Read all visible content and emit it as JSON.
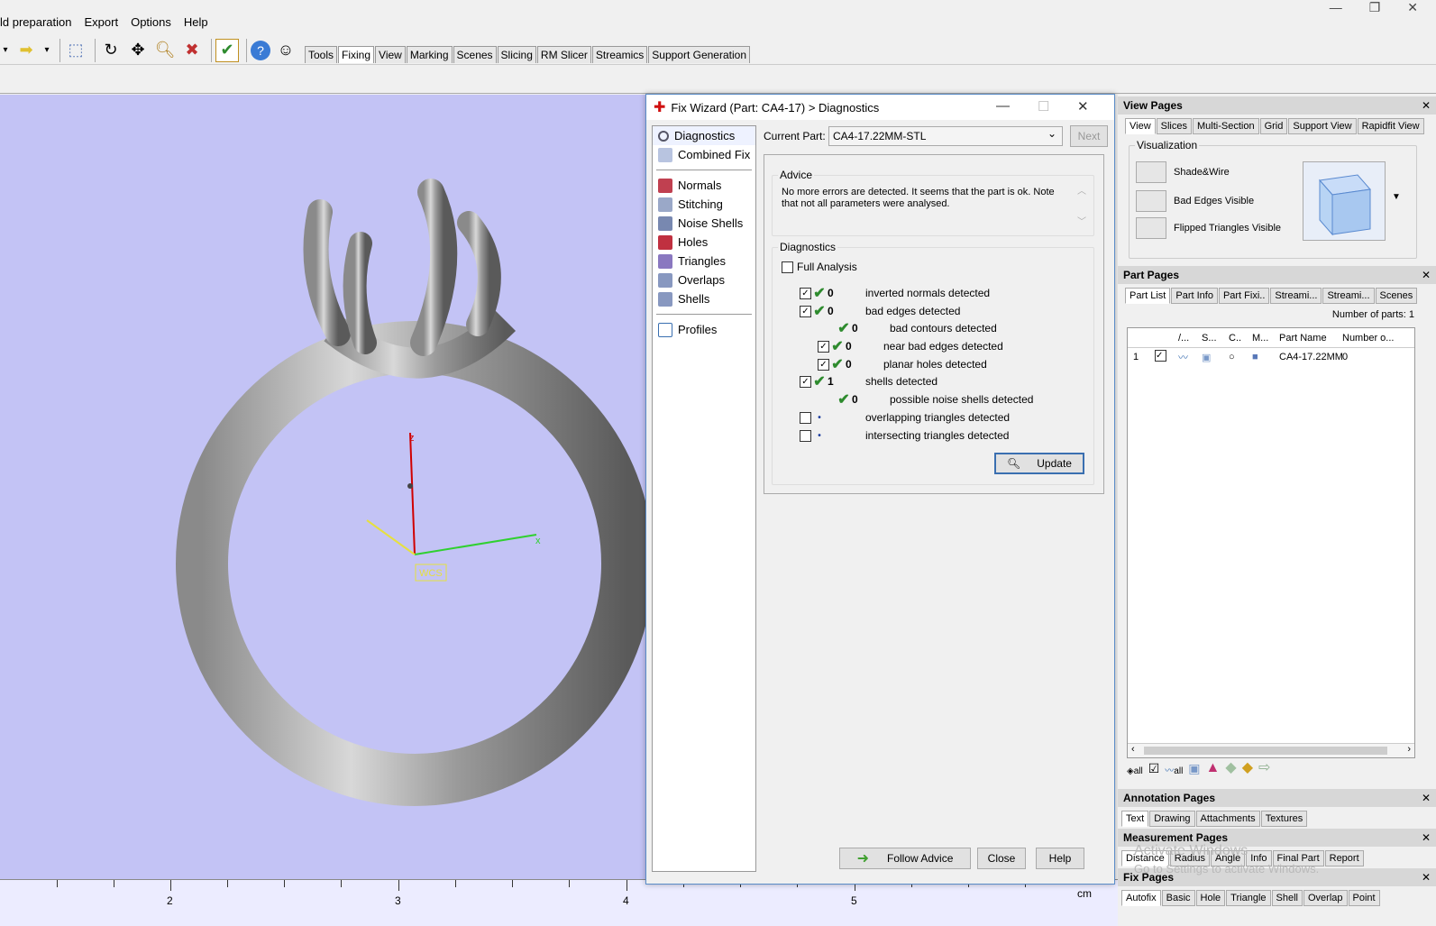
{
  "menu": [
    "ld preparation",
    "Export",
    "Options",
    "Help"
  ],
  "toolbar_tabs": [
    "Tools",
    "Fixing",
    "View",
    "Marking",
    "Scenes",
    "Slicing",
    "RM Slicer",
    "Streamics",
    "Support Generation"
  ],
  "active_tab": "Fixing",
  "viewport": {
    "axis_z": "z",
    "axis_x": "x",
    "wcs": "WCS",
    "ruler_numbers": [
      "2",
      "3",
      "4",
      "5"
    ],
    "unit": "cm"
  },
  "dialog": {
    "title": "Fix Wizard (Part: CA4-17) > Diagnostics",
    "nav_top": [
      "Diagnostics",
      "Combined Fix"
    ],
    "nav_mid": [
      "Normals",
      "Stitching",
      "Noise Shells",
      "Holes",
      "Triangles",
      "Overlaps",
      "Shells"
    ],
    "nav_bottom": [
      "Profiles"
    ],
    "current_part_label": "Current Part:",
    "current_part_value": "CA4-17.22MM-STL",
    "next_label": "Next",
    "advice_label": "Advice",
    "advice_text": "No more errors are detected. It seems that the part is ok. Note that not all parameters were analysed.",
    "diagnostics_label": "Diagnostics",
    "full_analysis": "Full Analysis",
    "rows": [
      {
        "num": "0",
        "text": "inverted normals detected"
      },
      {
        "num": "0",
        "text": "bad edges detected"
      },
      {
        "num": "0",
        "text": "bad contours detected"
      },
      {
        "num": "0",
        "text": "near bad edges detected"
      },
      {
        "num": "0",
        "text": "planar holes detected"
      },
      {
        "num": "1",
        "text": "shells detected"
      },
      {
        "num": "0",
        "text": "possible noise shells detected"
      },
      {
        "num": "",
        "text": "overlapping triangles detected"
      },
      {
        "num": "",
        "text": "intersecting triangles detected"
      }
    ],
    "update_label": "Update",
    "follow_advice": "Follow Advice",
    "close_label": "Close",
    "help_label": "Help"
  },
  "dock": {
    "view_pages": "View Pages",
    "view_tabs": [
      "View",
      "Slices",
      "Multi-Section",
      "Grid",
      "Support View",
      "Rapidfit View"
    ],
    "visualization": "Visualization",
    "vis_items": [
      "Shade&Wire",
      "Bad Edges Visible",
      "Flipped Triangles Visible"
    ],
    "part_pages": "Part Pages",
    "part_tabs": [
      "Part List",
      "Part Info",
      "Part Fixi..",
      "Streami...",
      "Streami...",
      "Scenes"
    ],
    "num_parts": "Number of parts: 1",
    "cols": [
      "/...",
      "S...",
      "C..",
      "M...",
      "Part Name",
      "Number o..."
    ],
    "row": {
      "idx": "1",
      "name": "CA4-17.22MM",
      "count": "0"
    },
    "bottom_labels": [
      "all",
      "all"
    ],
    "annotation_pages": "Annotation Pages",
    "annotation_tabs": [
      "Text",
      "Drawing",
      "Attachments",
      "Textures"
    ],
    "measurement_pages": "Measurement Pages",
    "measurement_tabs": [
      "Distance",
      "Radius",
      "Angle",
      "Info",
      "Final Part",
      "Report"
    ],
    "fix_pages": "Fix Pages",
    "fix_tabs": [
      "Autofix",
      "Basic",
      "Hole",
      "Triangle",
      "Shell",
      "Overlap",
      "Point"
    ],
    "watermark1": "Activate Windows",
    "watermark2": "Go to Settings to activate Windows."
  },
  "colors": {
    "viewport_bg": "#c3c3f5",
    "ok_green": "#2e8b2e"
  }
}
